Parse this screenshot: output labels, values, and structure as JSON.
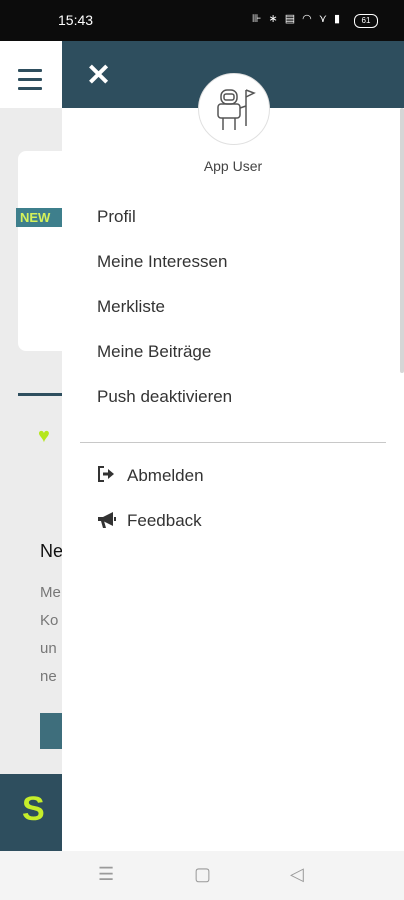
{
  "status_bar": {
    "time": "15:43",
    "icons": "⊪ ∗ ▤ ◠ ⋎ ▮",
    "battery": "61"
  },
  "background": {
    "badge": "NEW",
    "title": "Ne",
    "text_lines": [
      "Me",
      "Ko",
      "un",
      "ne"
    ],
    "logo": "S"
  },
  "drawer": {
    "close_glyph": "✕",
    "user_name": "App User",
    "menu_items": [
      "Profil",
      "Meine Interessen",
      "Merkliste",
      "Meine Beiträge",
      "Push deaktivieren"
    ],
    "secondary_items": [
      {
        "label": "Abmelden",
        "icon": "logout-icon"
      },
      {
        "label": "Feedback",
        "icon": "megaphone-icon"
      }
    ]
  },
  "nav_bar": {
    "menu": "☰",
    "home": "▢",
    "back": "◁"
  },
  "colors": {
    "header": "#2e4e5e",
    "accent": "#c6ee2a"
  }
}
